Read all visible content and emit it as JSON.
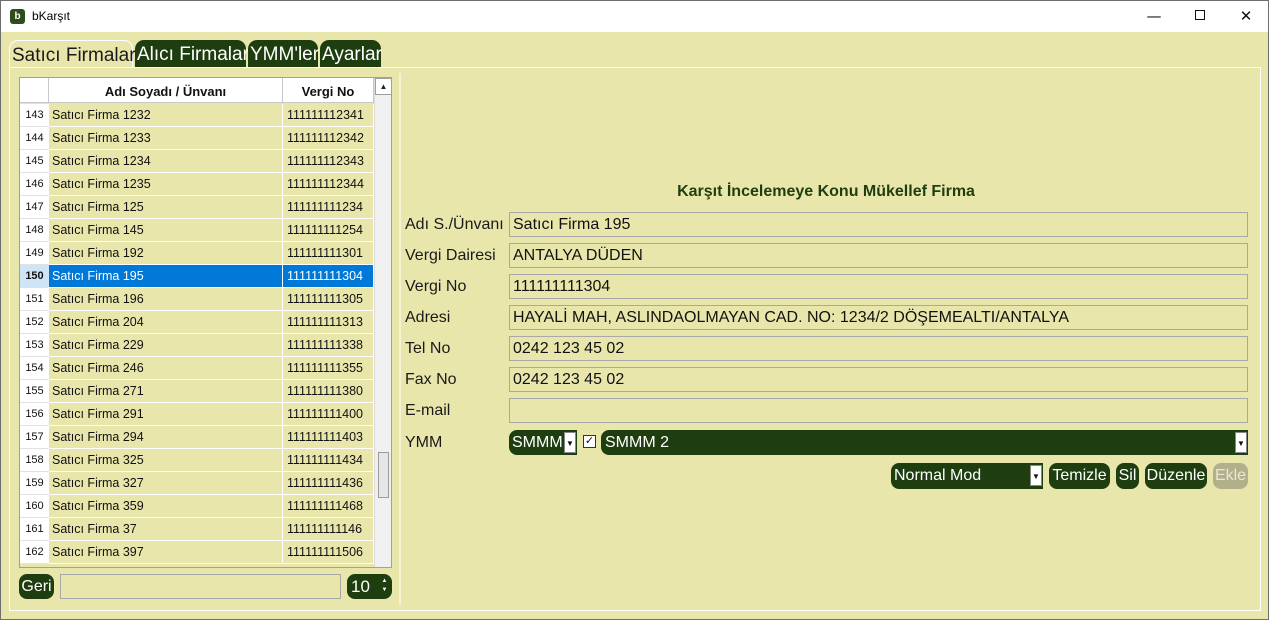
{
  "window": {
    "title": "bKarşıt",
    "icon_letter": "b"
  },
  "tabs": [
    {
      "label": "Satıcı Firmalar",
      "active": true
    },
    {
      "label": "Alıcı Firmalar",
      "active": false
    },
    {
      "label": "YMM'ler",
      "active": false
    },
    {
      "label": "Ayarlar",
      "active": false
    }
  ],
  "grid": {
    "columns": {
      "name": "Adı Soyadı / Ünvanı",
      "vergi": "Vergi No"
    },
    "rows": [
      {
        "num": "143",
        "name": "Satıcı Firma 1232",
        "vergi": "111111112341"
      },
      {
        "num": "144",
        "name": "Satıcı Firma 1233",
        "vergi": "111111112342"
      },
      {
        "num": "145",
        "name": "Satıcı Firma 1234",
        "vergi": "111111112343"
      },
      {
        "num": "146",
        "name": "Satıcı Firma 1235",
        "vergi": "111111112344"
      },
      {
        "num": "147",
        "name": "Satıcı Firma 125",
        "vergi": "111111111234"
      },
      {
        "num": "148",
        "name": "Satıcı Firma 145",
        "vergi": "111111111254"
      },
      {
        "num": "149",
        "name": "Satıcı Firma 192",
        "vergi": "111111111301"
      },
      {
        "num": "150",
        "name": "Satıcı Firma 195",
        "vergi": "111111111304",
        "selected": true
      },
      {
        "num": "151",
        "name": "Satıcı Firma 196",
        "vergi": "111111111305"
      },
      {
        "num": "152",
        "name": "Satıcı Firma 204",
        "vergi": "111111111313"
      },
      {
        "num": "153",
        "name": "Satıcı Firma 229",
        "vergi": "111111111338"
      },
      {
        "num": "154",
        "name": "Satıcı Firma 246",
        "vergi": "111111111355"
      },
      {
        "num": "155",
        "name": "Satıcı Firma 271",
        "vergi": "111111111380"
      },
      {
        "num": "156",
        "name": "Satıcı Firma 291",
        "vergi": "111111111400"
      },
      {
        "num": "157",
        "name": "Satıcı Firma 294",
        "vergi": "111111111403"
      },
      {
        "num": "158",
        "name": "Satıcı Firma 325",
        "vergi": "111111111434"
      },
      {
        "num": "159",
        "name": "Satıcı Firma 327",
        "vergi": "111111111436"
      },
      {
        "num": "160",
        "name": "Satıcı Firma 359",
        "vergi": "111111111468"
      },
      {
        "num": "161",
        "name": "Satıcı Firma 37",
        "vergi": "111111111146"
      },
      {
        "num": "162",
        "name": "Satıcı Firma 397",
        "vergi": "111111111506"
      }
    ]
  },
  "nav": {
    "back_label": "Geri",
    "page_value": "",
    "page_size": "10"
  },
  "form": {
    "title": "Karşıt İncelemeye Konu Mükellef Firma",
    "fields": {
      "name": {
        "label": "Adı S./Ünvanı",
        "value": "Satıcı Firma 195"
      },
      "office": {
        "label": "Vergi Dairesi",
        "value": "ANTALYA DÜDEN"
      },
      "taxno": {
        "label": "Vergi No",
        "value": "111111111304"
      },
      "address": {
        "label": "Adresi",
        "value": "HAYALİ MAH, ASLINDAOLMAYAN CAD. NO: 1234/2 DÖŞEMEALTI/ANTALYA"
      },
      "tel": {
        "label": "Tel No",
        "value": "0242 123 45 02"
      },
      "fax": {
        "label": "Fax No",
        "value": "0242 123 45 02"
      },
      "email": {
        "label": "E-mail",
        "value": ""
      }
    },
    "ymm": {
      "label": "YMM",
      "type_value": "SMMM",
      "checked": true,
      "selected": "SMMM 2"
    },
    "actions": {
      "mode": "Normal Mod",
      "clear": "Temizle",
      "delete": "Sil",
      "edit": "Düzenle",
      "add": "Ekle"
    }
  },
  "colors": {
    "dark_green": "#1e3e10",
    "background": "#e9e6ac",
    "selection": "#0078d7"
  }
}
